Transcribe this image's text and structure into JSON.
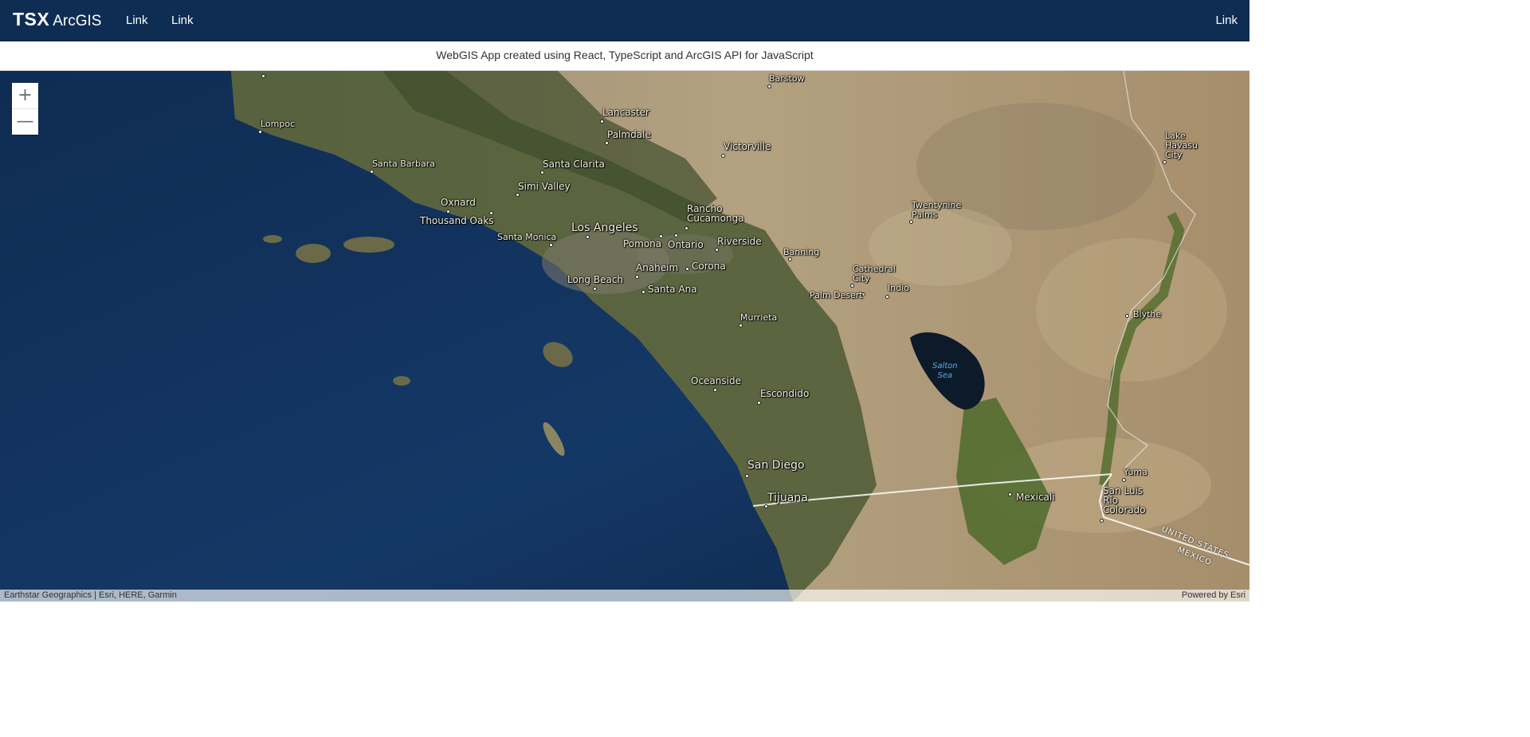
{
  "navbar": {
    "brand_strong": "TSX",
    "brand_light": "ArcGIS",
    "links": [
      "Link",
      "Link"
    ],
    "right_link": "Link",
    "bg_color": "#0f2d52"
  },
  "subtitle": "WebGIS App created using React, TypeScript and ArcGIS API for JavaScript",
  "map": {
    "basemap": "imagery",
    "zoom_in_icon": "plus-icon",
    "zoom_out_icon": "minus-icon",
    "zoom_in": "+",
    "zoom_out": "—",
    "labels": {
      "barstow": "Barstow",
      "lompoc": "Lompoc",
      "lancaster": "Lancaster",
      "palmdale": "Palmdale",
      "victorville": "Victorville",
      "santa_barbara": "Santa Barbara",
      "santa_clarita": "Santa Clarita",
      "simi_valley": "Simi Valley",
      "oxnard": "Oxnard",
      "thousand_oaks": "Thousand Oaks",
      "santa_monica": "Santa Monica",
      "los_angeles": "Los Angeles",
      "rancho_cucamonga": "Rancho\nCucamonga",
      "pomona": "Pomona",
      "ontario": "Ontario",
      "riverside": "Riverside",
      "banning": "Banning",
      "twentynine_palms": "Twentynine\nPalms",
      "lake_havasu_city": "Lake\nHavasu\nCity",
      "cathedral_city": "Cathedral\nCity",
      "palm_desert": "Palm Desert",
      "indio": "Indio",
      "anaheim": "Anaheim",
      "corona": "Corona",
      "long_beach": "Long Beach",
      "santa_ana": "Santa Ana",
      "murrieta": "Murrieta",
      "blythe": "Blythe",
      "salton_sea": "Salton\nSea",
      "oceanside": "Oceanside",
      "escondido": "Escondido",
      "san_diego": "San Diego",
      "tijuana": "Tijuana",
      "mexicali": "Mexicali",
      "yuma": "Yuma",
      "san_luis_rio_colorado": "San Luis\nRío\nColorado",
      "united_states": "UNITED STATES",
      "mexico": "MEXICO"
    }
  },
  "attribution": {
    "left": "Earthstar Geographics | Esri, HERE, Garmin",
    "right": "Powered by Esri"
  }
}
